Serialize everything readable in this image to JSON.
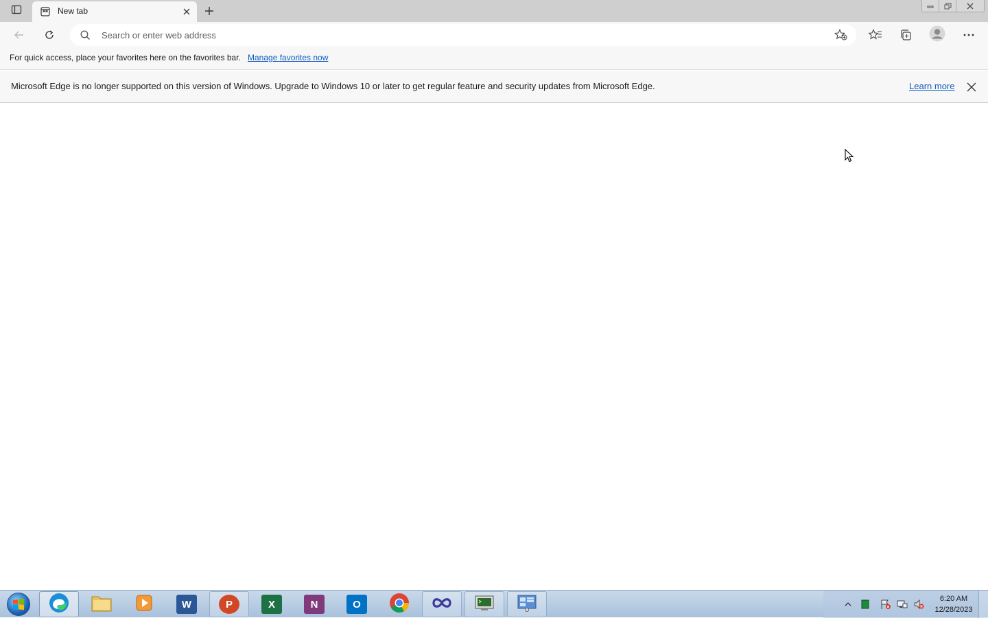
{
  "tab": {
    "title": "New tab"
  },
  "address_bar": {
    "placeholder": "Search or enter web address"
  },
  "favorites_bar": {
    "message": "For quick access, place your favorites here on the favorites bar.",
    "link": "Manage favorites now"
  },
  "info_bar": {
    "message": "Microsoft Edge is no longer supported on this version of Windows. Upgrade to Windows 10 or later to get regular feature and security updates from Microsoft Edge.",
    "link": "Learn more"
  },
  "taskbar": {
    "apps": [
      {
        "name": "edge",
        "icon": "edge-icon",
        "letter": "",
        "color": "#1a8fd6"
      },
      {
        "name": "explorer",
        "icon": "folder-icon",
        "letter": "",
        "color": "#e8c25b"
      },
      {
        "name": "media-player",
        "icon": "media-player-icon",
        "letter": "",
        "color": "#f29a36"
      },
      {
        "name": "word",
        "icon": "word-icon",
        "letter": "W",
        "color": "#2b5797"
      },
      {
        "name": "powerpoint",
        "icon": "powerpoint-icon",
        "letter": "P",
        "color": "#d24726"
      },
      {
        "name": "excel",
        "icon": "excel-icon",
        "letter": "X",
        "color": "#1e7145"
      },
      {
        "name": "onenote",
        "icon": "onenote-icon",
        "letter": "N",
        "color": "#80397b"
      },
      {
        "name": "outlook",
        "icon": "outlook-icon",
        "letter": "O",
        "color": "#0072c6"
      },
      {
        "name": "chrome",
        "icon": "chrome-icon",
        "letter": "",
        "color": "#4285f4"
      },
      {
        "name": "visual-studio",
        "icon": "infinity-icon",
        "letter": "",
        "color": "#3b3b9a"
      },
      {
        "name": "terminal",
        "icon": "terminal-icon",
        "letter": "",
        "color": "#2f6b2f"
      },
      {
        "name": "control-panel",
        "icon": "control-panel-icon",
        "letter": "",
        "color": "#5b8fd0"
      }
    ],
    "clock": {
      "time": "6:20 AM",
      "date": "12/28/2023"
    }
  }
}
